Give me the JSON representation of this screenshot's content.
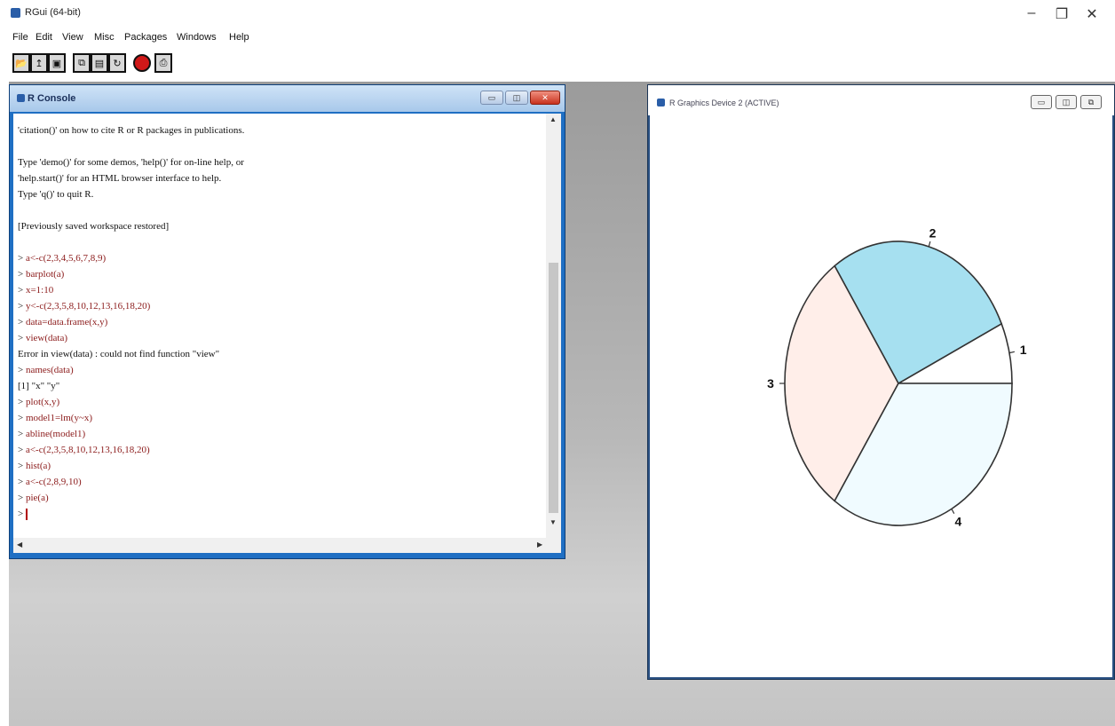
{
  "app": {
    "title": "RGui (64-bit)",
    "minimize": "–",
    "restore": "❐",
    "close": "✕"
  },
  "menu": [
    "File",
    "Edit",
    "View",
    "Misc",
    "Packages",
    "Windows",
    "Help"
  ],
  "toolbar": {
    "buttons": [
      "open-script-icon",
      "load-workspace-icon",
      "save-workspace-icon",
      "copy-icon",
      "paste-icon",
      "copy-paste-icon",
      "stop-icon",
      "print-icon"
    ]
  },
  "console": {
    "title": "R Console",
    "lines": [
      {
        "text": "'citation()' on how to cite R or R packages in publications.",
        "kind": "out"
      },
      {
        "text": "",
        "kind": "out"
      },
      {
        "text": "Type 'demo()' for some demos, 'help()' for on-line help, or",
        "kind": "out"
      },
      {
        "text": "'help.start()' for an HTML browser interface to help.",
        "kind": "out"
      },
      {
        "text": "Type 'q()' to quit R.",
        "kind": "out"
      },
      {
        "text": "",
        "kind": "out"
      },
      {
        "text": "[Previously saved workspace restored]",
        "kind": "out"
      },
      {
        "text": "",
        "kind": "out"
      },
      {
        "text": "a<-c(2,3,4,5,6,7,8,9)",
        "kind": "cmd"
      },
      {
        "text": "barplot(a)",
        "kind": "cmd"
      },
      {
        "text": "x=1:10",
        "kind": "cmd"
      },
      {
        "text": "y<-c(2,3,5,8,10,12,13,16,18,20)",
        "kind": "cmd"
      },
      {
        "text": "data=data.frame(x,y)",
        "kind": "cmd"
      },
      {
        "text": "view(data)",
        "kind": "cmd"
      },
      {
        "text": "Error in view(data) : could not find function \"view\"",
        "kind": "out"
      },
      {
        "text": "names(data)",
        "kind": "cmd"
      },
      {
        "text": "[1] \"x\" \"y\"",
        "kind": "out"
      },
      {
        "text": "plot(x,y)",
        "kind": "cmd"
      },
      {
        "text": "model1=lm(y~x)",
        "kind": "cmd"
      },
      {
        "text": "abline(model1)",
        "kind": "cmd"
      },
      {
        "text": "a<-c(2,3,5,8,10,12,13,16,18,20)",
        "kind": "cmd"
      },
      {
        "text": "hist(a)",
        "kind": "cmd"
      },
      {
        "text": "a<-c(2,8,9,10)",
        "kind": "cmd"
      },
      {
        "text": "pie(a)",
        "kind": "cmd"
      }
    ],
    "prompt": ">"
  },
  "graphics": {
    "title": "R Graphics Device 2 (ACTIVE)"
  },
  "chart_data": {
    "type": "pie",
    "labels": [
      "1",
      "2",
      "3",
      "4"
    ],
    "values": [
      2,
      8,
      9,
      10
    ],
    "colors": [
      "#ffffff",
      "#a6e0f0",
      "#ffeee9",
      "#f0fbff"
    ]
  }
}
